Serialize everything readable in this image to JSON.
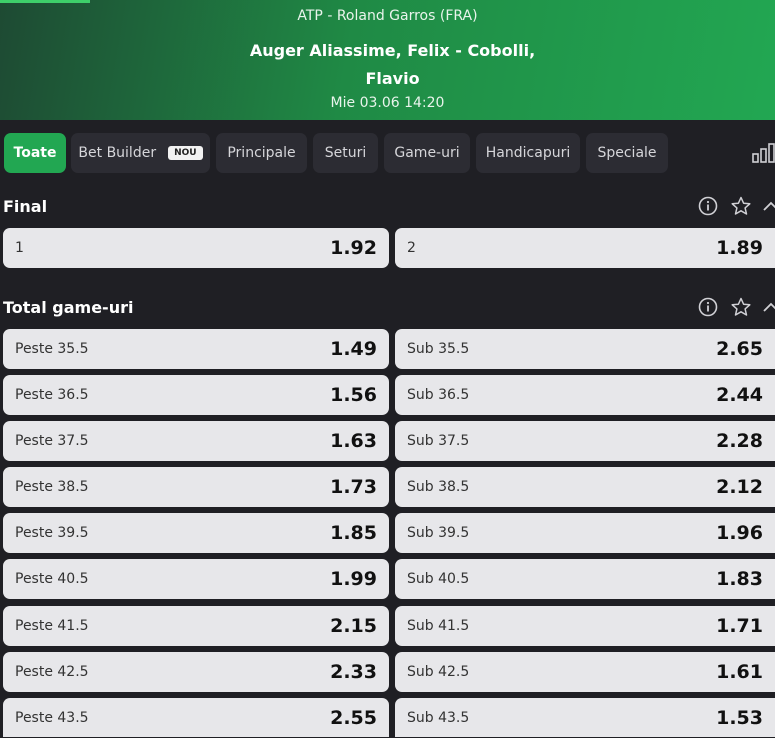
{
  "header": {
    "competition": "ATP - Roland Garros (FRA)",
    "match": "Auger Aliassime, Felix - Cobolli, Flavio",
    "datetime": "Mie 03.06 14:20"
  },
  "tabs": [
    {
      "label": "Toate",
      "active": true
    },
    {
      "label": "Bet Builder",
      "badge": "NOU"
    },
    {
      "label": "Principale"
    },
    {
      "label": "Seturi"
    },
    {
      "label": "Game-uri"
    },
    {
      "label": "Handicapuri"
    },
    {
      "label": "Speciale"
    }
  ],
  "icons": {
    "stats": "bar-chart-icon",
    "info": "info-icon",
    "favorite": "star-icon",
    "collapse": "chevron-up-icon"
  },
  "sections": {
    "final": {
      "title": "Final",
      "odds": [
        {
          "label": "1",
          "value": "1.92"
        },
        {
          "label": "2",
          "value": "1.89"
        }
      ]
    },
    "total_games": {
      "title": "Total game-uri",
      "rows": [
        {
          "over_label": "Peste 35.5",
          "over_value": "1.49",
          "under_label": "Sub 35.5",
          "under_value": "2.65"
        },
        {
          "over_label": "Peste 36.5",
          "over_value": "1.56",
          "under_label": "Sub 36.5",
          "under_value": "2.44"
        },
        {
          "over_label": "Peste 37.5",
          "over_value": "1.63",
          "under_label": "Sub 37.5",
          "under_value": "2.28"
        },
        {
          "over_label": "Peste 38.5",
          "over_value": "1.73",
          "under_label": "Sub 38.5",
          "under_value": "2.12"
        },
        {
          "over_label": "Peste 39.5",
          "over_value": "1.85",
          "under_label": "Sub 39.5",
          "under_value": "1.96"
        },
        {
          "over_label": "Peste 40.5",
          "over_value": "1.99",
          "under_label": "Sub 40.5",
          "under_value": "1.83"
        },
        {
          "over_label": "Peste 41.5",
          "over_value": "2.15",
          "under_label": "Sub 41.5",
          "under_value": "1.71"
        },
        {
          "over_label": "Peste 42.5",
          "over_value": "2.33",
          "under_label": "Sub 42.5",
          "under_value": "1.61"
        },
        {
          "over_label": "Peste 43.5",
          "over_value": "2.55",
          "under_label": "Sub 43.5",
          "under_value": "1.53"
        }
      ]
    }
  },
  "colors": {
    "accent": "#22a752",
    "background": "#1f1f24",
    "tab_bg": "#2c2c33",
    "odd_bg": "#e7e7ea"
  }
}
